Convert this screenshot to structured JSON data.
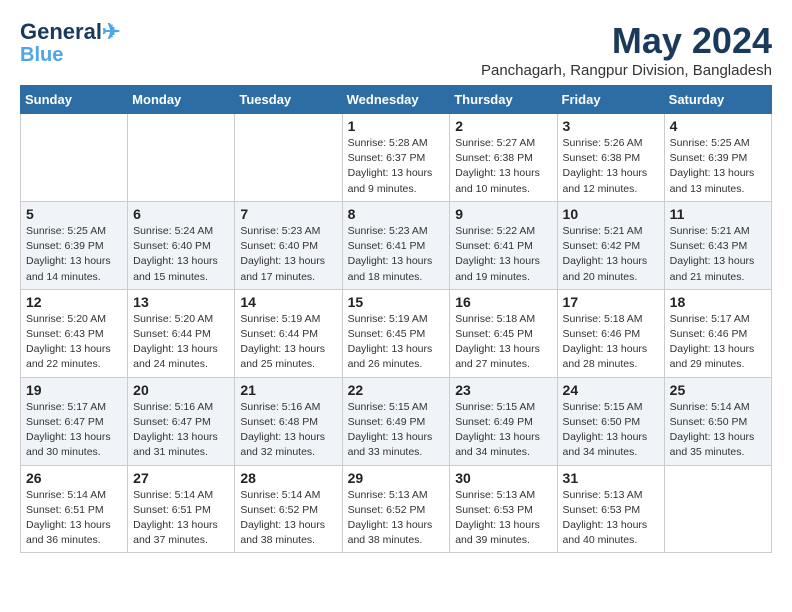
{
  "logo": {
    "line1": "General",
    "line2": "Blue"
  },
  "title": "May 2024",
  "subtitle": "Panchagarh, Rangpur Division, Bangladesh",
  "days_of_week": [
    "Sunday",
    "Monday",
    "Tuesday",
    "Wednesday",
    "Thursday",
    "Friday",
    "Saturday"
  ],
  "weeks": [
    [
      {
        "day": "",
        "detail": ""
      },
      {
        "day": "",
        "detail": ""
      },
      {
        "day": "",
        "detail": ""
      },
      {
        "day": "1",
        "detail": "Sunrise: 5:28 AM\nSunset: 6:37 PM\nDaylight: 13 hours\nand 9 minutes."
      },
      {
        "day": "2",
        "detail": "Sunrise: 5:27 AM\nSunset: 6:38 PM\nDaylight: 13 hours\nand 10 minutes."
      },
      {
        "day": "3",
        "detail": "Sunrise: 5:26 AM\nSunset: 6:38 PM\nDaylight: 13 hours\nand 12 minutes."
      },
      {
        "day": "4",
        "detail": "Sunrise: 5:25 AM\nSunset: 6:39 PM\nDaylight: 13 hours\nand 13 minutes."
      }
    ],
    [
      {
        "day": "5",
        "detail": "Sunrise: 5:25 AM\nSunset: 6:39 PM\nDaylight: 13 hours\nand 14 minutes."
      },
      {
        "day": "6",
        "detail": "Sunrise: 5:24 AM\nSunset: 6:40 PM\nDaylight: 13 hours\nand 15 minutes."
      },
      {
        "day": "7",
        "detail": "Sunrise: 5:23 AM\nSunset: 6:40 PM\nDaylight: 13 hours\nand 17 minutes."
      },
      {
        "day": "8",
        "detail": "Sunrise: 5:23 AM\nSunset: 6:41 PM\nDaylight: 13 hours\nand 18 minutes."
      },
      {
        "day": "9",
        "detail": "Sunrise: 5:22 AM\nSunset: 6:41 PM\nDaylight: 13 hours\nand 19 minutes."
      },
      {
        "day": "10",
        "detail": "Sunrise: 5:21 AM\nSunset: 6:42 PM\nDaylight: 13 hours\nand 20 minutes."
      },
      {
        "day": "11",
        "detail": "Sunrise: 5:21 AM\nSunset: 6:43 PM\nDaylight: 13 hours\nand 21 minutes."
      }
    ],
    [
      {
        "day": "12",
        "detail": "Sunrise: 5:20 AM\nSunset: 6:43 PM\nDaylight: 13 hours\nand 22 minutes."
      },
      {
        "day": "13",
        "detail": "Sunrise: 5:20 AM\nSunset: 6:44 PM\nDaylight: 13 hours\nand 24 minutes."
      },
      {
        "day": "14",
        "detail": "Sunrise: 5:19 AM\nSunset: 6:44 PM\nDaylight: 13 hours\nand 25 minutes."
      },
      {
        "day": "15",
        "detail": "Sunrise: 5:19 AM\nSunset: 6:45 PM\nDaylight: 13 hours\nand 26 minutes."
      },
      {
        "day": "16",
        "detail": "Sunrise: 5:18 AM\nSunset: 6:45 PM\nDaylight: 13 hours\nand 27 minutes."
      },
      {
        "day": "17",
        "detail": "Sunrise: 5:18 AM\nSunset: 6:46 PM\nDaylight: 13 hours\nand 28 minutes."
      },
      {
        "day": "18",
        "detail": "Sunrise: 5:17 AM\nSunset: 6:46 PM\nDaylight: 13 hours\nand 29 minutes."
      }
    ],
    [
      {
        "day": "19",
        "detail": "Sunrise: 5:17 AM\nSunset: 6:47 PM\nDaylight: 13 hours\nand 30 minutes."
      },
      {
        "day": "20",
        "detail": "Sunrise: 5:16 AM\nSunset: 6:47 PM\nDaylight: 13 hours\nand 31 minutes."
      },
      {
        "day": "21",
        "detail": "Sunrise: 5:16 AM\nSunset: 6:48 PM\nDaylight: 13 hours\nand 32 minutes."
      },
      {
        "day": "22",
        "detail": "Sunrise: 5:15 AM\nSunset: 6:49 PM\nDaylight: 13 hours\nand 33 minutes."
      },
      {
        "day": "23",
        "detail": "Sunrise: 5:15 AM\nSunset: 6:49 PM\nDaylight: 13 hours\nand 34 minutes."
      },
      {
        "day": "24",
        "detail": "Sunrise: 5:15 AM\nSunset: 6:50 PM\nDaylight: 13 hours\nand 34 minutes."
      },
      {
        "day": "25",
        "detail": "Sunrise: 5:14 AM\nSunset: 6:50 PM\nDaylight: 13 hours\nand 35 minutes."
      }
    ],
    [
      {
        "day": "26",
        "detail": "Sunrise: 5:14 AM\nSunset: 6:51 PM\nDaylight: 13 hours\nand 36 minutes."
      },
      {
        "day": "27",
        "detail": "Sunrise: 5:14 AM\nSunset: 6:51 PM\nDaylight: 13 hours\nand 37 minutes."
      },
      {
        "day": "28",
        "detail": "Sunrise: 5:14 AM\nSunset: 6:52 PM\nDaylight: 13 hours\nand 38 minutes."
      },
      {
        "day": "29",
        "detail": "Sunrise: 5:13 AM\nSunset: 6:52 PM\nDaylight: 13 hours\nand 38 minutes."
      },
      {
        "day": "30",
        "detail": "Sunrise: 5:13 AM\nSunset: 6:53 PM\nDaylight: 13 hours\nand 39 minutes."
      },
      {
        "day": "31",
        "detail": "Sunrise: 5:13 AM\nSunset: 6:53 PM\nDaylight: 13 hours\nand 40 minutes."
      },
      {
        "day": "",
        "detail": ""
      }
    ]
  ]
}
